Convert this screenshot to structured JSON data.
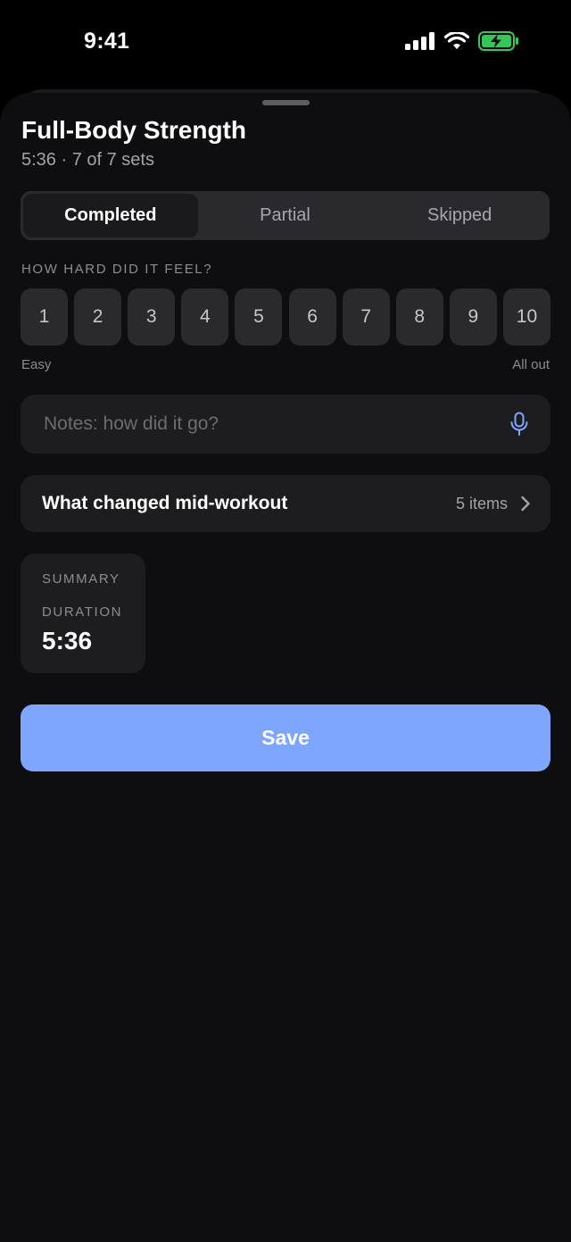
{
  "status_bar": {
    "time": "9:41"
  },
  "header": {
    "title": "Full-Body Strength",
    "subtitle": "5:36 · 7 of 7 sets"
  },
  "status_segments": [
    {
      "label": "Completed",
      "selected": true
    },
    {
      "label": "Partial",
      "selected": false
    },
    {
      "label": "Skipped",
      "selected": false
    }
  ],
  "effort": {
    "question": "HOW HARD DID IT FEEL?",
    "options": [
      "1",
      "2",
      "3",
      "4",
      "5",
      "6",
      "7",
      "8",
      "9",
      "10"
    ],
    "min_label": "Easy",
    "max_label": "All out"
  },
  "notes": {
    "value": "",
    "placeholder": "Notes: how did it go?"
  },
  "changes": {
    "label": "What changed mid-workout",
    "count": "5 items"
  },
  "summary": {
    "title": "SUMMARY",
    "duration_label": "DURATION",
    "duration_value": "5:36"
  },
  "actions": {
    "save_label": "Save"
  },
  "colors": {
    "background": "#0e0e10",
    "card": "#1d1d20",
    "segment_bg": "#2a2a2e",
    "accent": "#7ea6ff",
    "battery": "#34c759"
  },
  "icons": {
    "signal": "cellular-signal-icon",
    "wifi": "wifi-icon",
    "battery": "battery-charging-icon",
    "mic": "microphone-icon",
    "chevron": "chevron-right-icon"
  }
}
